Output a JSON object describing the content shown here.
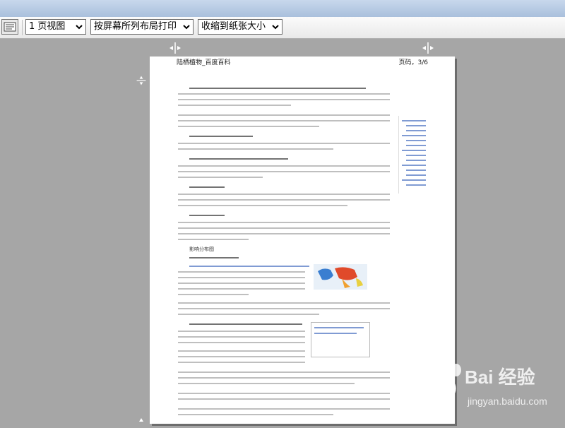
{
  "toolbar": {
    "view_select": "1 页视图",
    "layout_select": "按屏幕所列布局打印",
    "shrink_select": "收缩到纸张大小"
  },
  "page": {
    "header_left": "陆栖植物_百度百科",
    "header_right": "页码，3/6",
    "section_heading": "影响分布图"
  },
  "watermark": {
    "brand": "Bai 经验",
    "domain": "jingyan.baidu.com"
  }
}
